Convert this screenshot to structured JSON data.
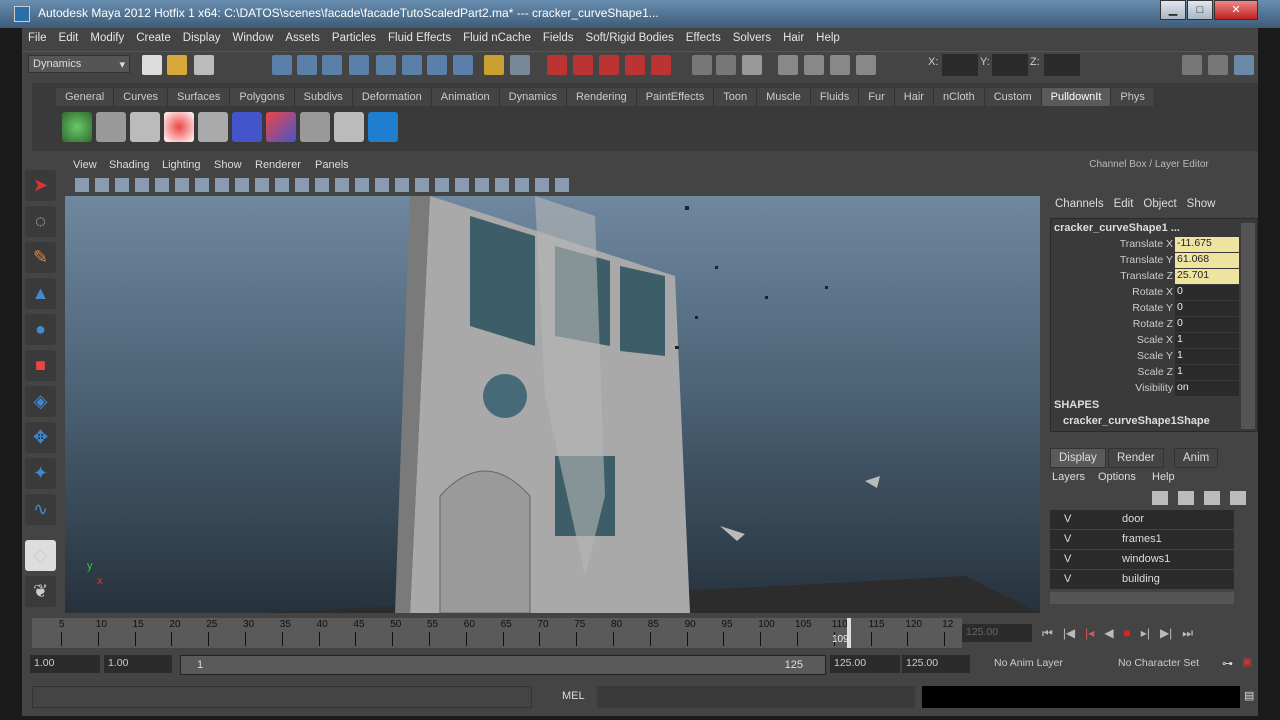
{
  "window": {
    "title": "Autodesk Maya 2012 Hotfix 1 x64: C:\\DATOS\\scenes\\facade\\facadeTutoScaledPart2.ma*   ---   cracker_curveShape1...",
    "min": "▁",
    "max": "□",
    "close": "✕"
  },
  "menu": [
    "File",
    "Edit",
    "Modify",
    "Create",
    "Display",
    "Window",
    "Assets",
    "Particles",
    "Fluid Effects",
    "Fluid nCache",
    "Fields",
    "Soft/Rigid Bodies",
    "Effects",
    "Solvers",
    "Hair",
    "Help"
  ],
  "status": {
    "mode": "Dynamics",
    "x_label": "X:",
    "y_label": "Y:",
    "z_label": "Z:"
  },
  "shelf": {
    "tabs": [
      "General",
      "Curves",
      "Surfaces",
      "Polygons",
      "Subdivs",
      "Deformation",
      "Animation",
      "Dynamics",
      "Rendering",
      "PaintEffects",
      "Toon",
      "Muscle",
      "Fluids",
      "Fur",
      "Hair",
      "nCloth",
      "Custom",
      "PulldownIt",
      "Phys"
    ],
    "active": "PulldownIt"
  },
  "viewport": {
    "menu": [
      "View",
      "Shading",
      "Lighting",
      "Show",
      "Renderer",
      "Panels"
    ],
    "axis_y": "y",
    "axis_x": "x"
  },
  "channel_box": {
    "title": "Channel Box / Layer Editor",
    "menu": [
      "Channels",
      "Edit",
      "Object",
      "Show"
    ],
    "object": "cracker_curveShape1 ...",
    "channels": [
      {
        "label": "Translate X",
        "value": "-11.675",
        "keyed": true
      },
      {
        "label": "Translate Y",
        "value": "61.068",
        "keyed": true
      },
      {
        "label": "Translate Z",
        "value": "25.701",
        "keyed": true
      },
      {
        "label": "Rotate X",
        "value": "0"
      },
      {
        "label": "Rotate Y",
        "value": "0"
      },
      {
        "label": "Rotate Z",
        "value": "0"
      },
      {
        "label": "Scale X",
        "value": "1"
      },
      {
        "label": "Scale Y",
        "value": "1"
      },
      {
        "label": "Scale Z",
        "value": "1"
      },
      {
        "label": "Visibility",
        "value": "on"
      }
    ],
    "shapes_label": "SHAPES",
    "shape": "cracker_curveShape1Shape"
  },
  "layers": {
    "tabs": [
      "Display",
      "Render",
      "Anim"
    ],
    "menu": [
      "Layers",
      "Options",
      "Help"
    ],
    "rows": [
      {
        "v": "V",
        "name": "door"
      },
      {
        "v": "V",
        "name": "frames1"
      },
      {
        "v": "V",
        "name": "windows1"
      },
      {
        "v": "V",
        "name": "building"
      }
    ]
  },
  "timeline": {
    "ticks": [
      "5",
      "10",
      "15",
      "20",
      "25",
      "30",
      "35",
      "40",
      "45",
      "50",
      "55",
      "60",
      "65",
      "70",
      "75",
      "80",
      "85",
      "90",
      "95",
      "100",
      "105",
      "110",
      "115",
      "120",
      "12"
    ],
    "current": "109",
    "current_field": "125.00"
  },
  "range": {
    "start": "1.00",
    "playstart": "1.00",
    "slider_start": "1",
    "slider_end": "125",
    "playend": "125.00",
    "end": "125.00",
    "anim_layer": "No Anim Layer",
    "char_set": "No Character Set"
  },
  "cmd": {
    "label": "MEL"
  }
}
